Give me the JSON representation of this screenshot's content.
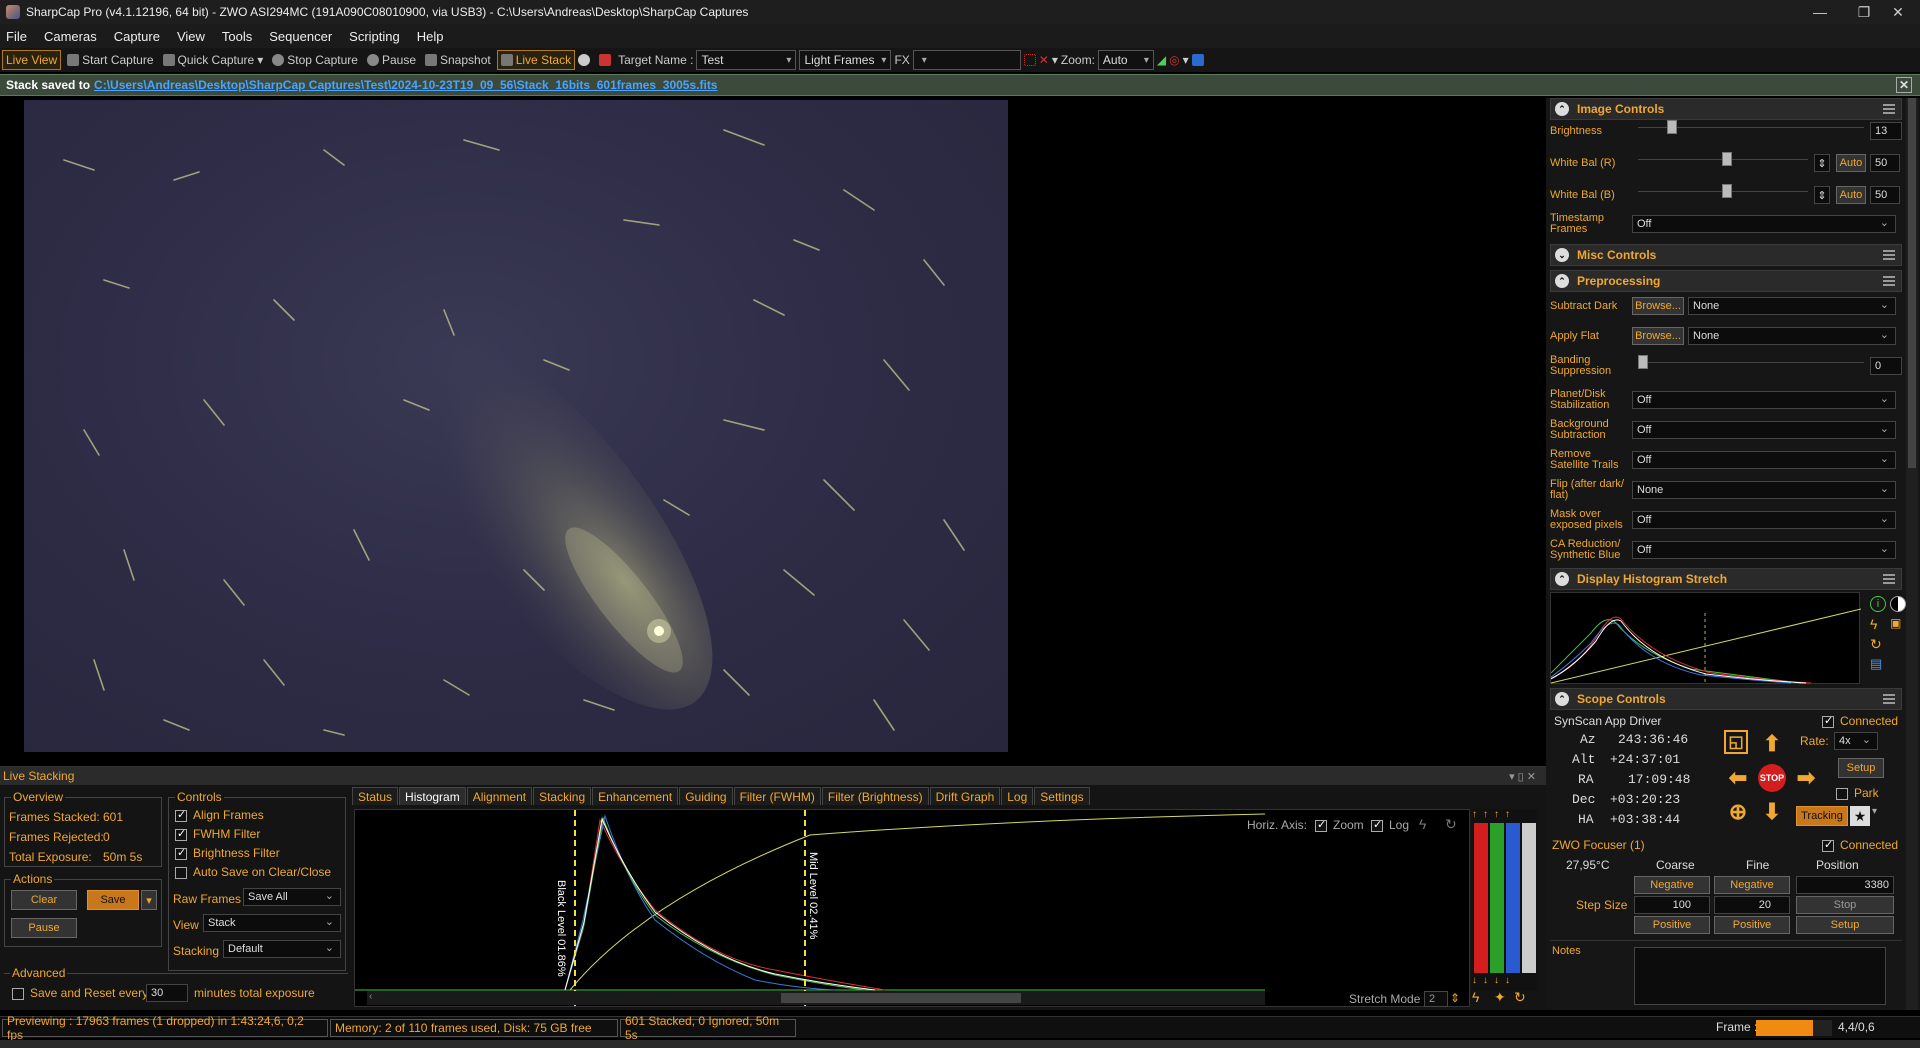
{
  "window": {
    "title": "SharpCap Pro (v4.1.12196, 64 bit) - ZWO ASI294MC (191A090C08010900, via USB3) - C:\\Users\\Andreas\\Desktop\\SharpCap Captures",
    "minimize": "—",
    "maximize": "❐",
    "close": "✕"
  },
  "menu": [
    "File",
    "Cameras",
    "Capture",
    "View",
    "Tools",
    "Sequencer",
    "Scripting",
    "Help"
  ],
  "toolbar": {
    "live_view": "Live View",
    "start_capture": "Start Capture",
    "quick_capture": "Quick Capture",
    "stop_capture": "Stop Capture",
    "pause": "Pause",
    "snapshot": "Snapshot",
    "live_stack": "Live Stack",
    "target_label": "Target Name :",
    "target_value": "Test",
    "frame_type": "Light Frames",
    "fx_label": "FX",
    "zoom_label": "Zoom:",
    "zoom_value": "Auto"
  },
  "notice": {
    "prefix": "Stack saved to",
    "path": "C:\\Users\\Andreas\\Desktop\\SharpCap Captures\\Test\\2024-10-23T19_09_56\\Stack_16bits_601frames_3005s.fits",
    "close": "✕"
  },
  "image_controls": {
    "title": "Image Controls",
    "brightness_label": "Brightness",
    "brightness": "13",
    "brightness_level": 0.13,
    "wb_r_label": "White Bal (R)",
    "wb_r": "50",
    "wb_b_label": "White Bal (B)",
    "wb_b": "50",
    "auto": "Auto",
    "timestamp_label": "Timestamp Frames",
    "timestamp": "Off"
  },
  "misc": {
    "title": "Misc Controls"
  },
  "preprocessing": {
    "title": "Preprocessing",
    "browse": "Browse...",
    "rows": [
      {
        "label": "Subtract Dark",
        "value": "None",
        "browse": true
      },
      {
        "label": "Apply Flat",
        "value": "None",
        "browse": true
      },
      {
        "label": "Banding Suppression",
        "value": "0",
        "slider": true
      },
      {
        "label": "Planet/Disk Stabilization",
        "value": "Off"
      },
      {
        "label": "Background Subtraction",
        "value": "Off"
      },
      {
        "label": "Remove Satellite Trails",
        "value": "Off"
      },
      {
        "label": "Flip (after dark/ flat)",
        "value": "None"
      },
      {
        "label": "Mask over exposed pixels",
        "value": "Off"
      },
      {
        "label": "CA Reduction/ Synthetic Blue",
        "value": "Off"
      }
    ]
  },
  "display_hist": {
    "title": "Display Histogram Stretch"
  },
  "scope": {
    "title": "Scope Controls",
    "driver": "SynScan App Driver",
    "connected": "Connected",
    "az_label": "Az",
    "az": "243:36:46",
    "alt_label": "Alt",
    "alt": "+24:37:01",
    "ra_label": "RA",
    "ra": "17:09:48",
    "dec_label": "Dec",
    "dec": "+03:20:23",
    "ha_label": "HA",
    "ha": "+03:38:44",
    "rate_label": "Rate:",
    "rate": "4x",
    "setup": "Setup",
    "park": "Park",
    "tracking": "Tracking",
    "stop": "STOP"
  },
  "focuser": {
    "title": "ZWO Focuser (1)",
    "connected": "Connected",
    "temp": "27,95°C",
    "coarse": "Coarse",
    "fine": "Fine",
    "position": "Position",
    "negative": "Negative",
    "positive": "Positive",
    "pos_value": "3380",
    "step_label": "Step Size",
    "step_coarse": "100",
    "step_fine": "20",
    "stop": "Stop",
    "setup": "Setup"
  },
  "notes": {
    "label": "Notes"
  },
  "live_stacking": {
    "title": "Live Stacking",
    "overview": {
      "title": "Overview",
      "stacked_label": "Frames Stacked:",
      "stacked": "601",
      "rejected_label": "Frames Rejected:",
      "rejected": "0",
      "exposure_label": "Total Exposure:",
      "exposure": "50m 5s"
    },
    "actions": {
      "title": "Actions",
      "clear": "Clear",
      "save": "Save",
      "pause": "Pause"
    },
    "advanced": {
      "title": "Advanced",
      "save_reset": "Save and Reset every",
      "minutes": "30",
      "suffix": "minutes total exposure"
    },
    "controls": {
      "title": "Controls",
      "align": "Align Frames",
      "fwhm": "FWHM Filter",
      "brightness": "Brightness Filter",
      "autosave": "Auto Save on Clear/Close",
      "raw_label": "Raw Frames",
      "raw": "Save All",
      "view_label": "View",
      "view": "Stack",
      "stacking_label": "Stacking",
      "stacking": "Default"
    },
    "tabs": [
      "Status",
      "Histogram",
      "Alignment",
      "Stacking",
      "Enhancement",
      "Guiding",
      "Filter (FWHM)",
      "Filter (Brightness)",
      "Drift Graph",
      "Log",
      "Settings"
    ],
    "hist": {
      "horiz": "Horiz. Axis:",
      "zoom": "Zoom",
      "log": "Log",
      "black": "Black Level 01.86%",
      "mid": "Mid Level 02.41%",
      "stretch_mode": "Stretch Mode",
      "stretch_val": "2"
    }
  },
  "status": {
    "preview": "Previewing : 17963 frames (1 dropped) in 1:43:24,6, 0,2 fps",
    "memory": "Memory: 2 of 110 frames used, Disk: 75 GB free",
    "stack": "601 Stacked, 0 Ignored, 50m 5s",
    "frame_label": "Frame :",
    "frame_val": "4,4/0,6",
    "frame_fill": 0.75
  },
  "colors": {
    "accent": "#f0a830",
    "link": "#4aa3ff"
  }
}
